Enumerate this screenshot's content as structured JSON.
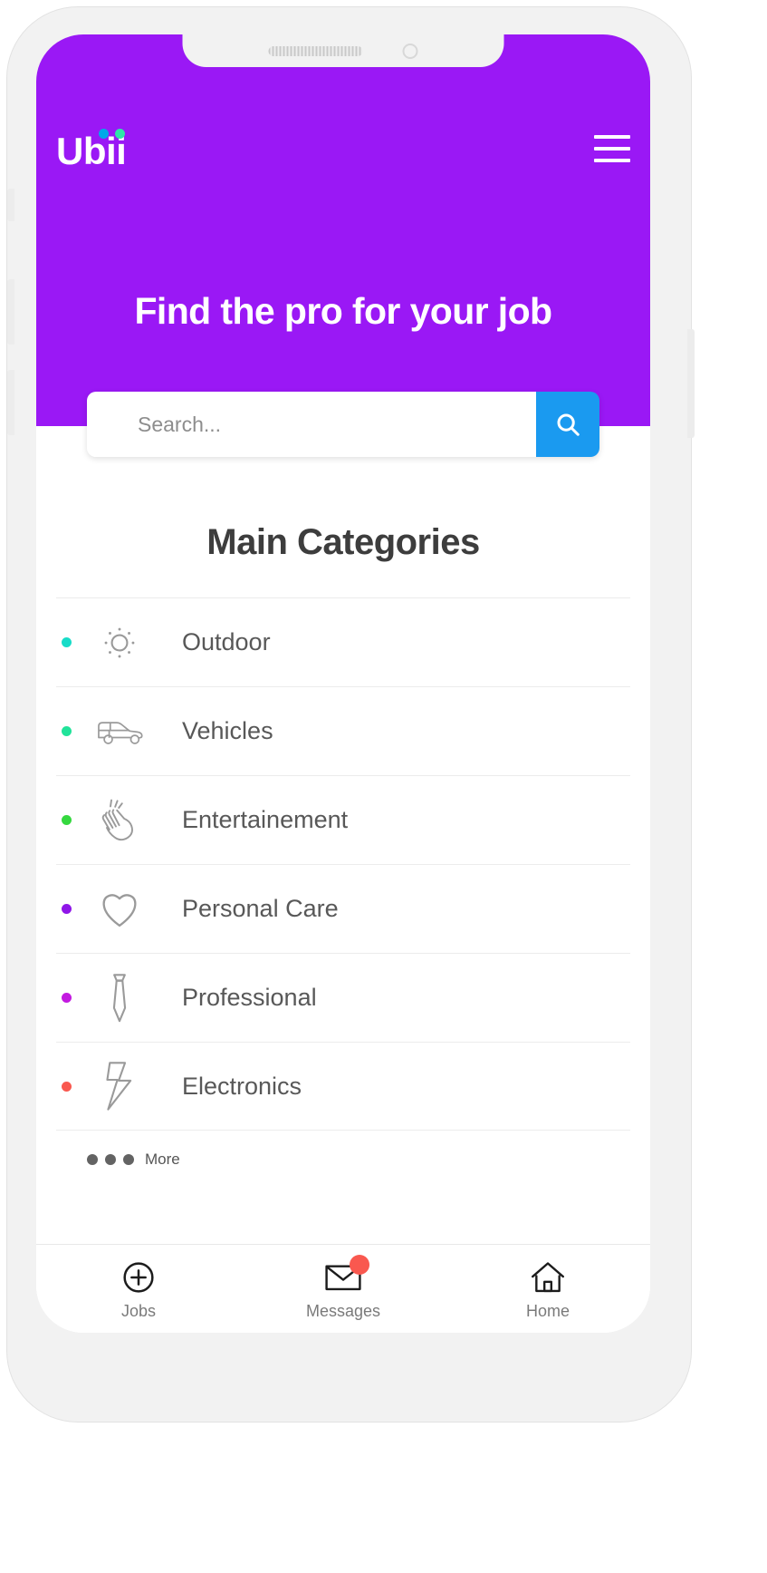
{
  "app": {
    "logo_text": "Ubii",
    "logo_dot_color_1": "#00a8e8",
    "logo_dot_color_2": "#2ee6a8",
    "brand_purple": "#9a18f5",
    "accent_blue": "#1a9af0"
  },
  "header": {
    "menu_icon": "hamburger-menu-icon"
  },
  "hero": {
    "title": "Find the pro for your job"
  },
  "search": {
    "placeholder": "Search...",
    "value": "",
    "button_icon": "search-icon"
  },
  "main": {
    "section_title": "Main Categories",
    "categories": [
      {
        "label": "Outdoor",
        "icon": "sun-icon",
        "dot_color": "#18dcc8"
      },
      {
        "label": "Vehicles",
        "icon": "car-icon",
        "dot_color": "#21e39a"
      },
      {
        "label": "Entertainement",
        "icon": "clapping-hands-icon",
        "dot_color": "#35d83f"
      },
      {
        "label": "Personal Care",
        "icon": "heart-shield-icon",
        "dot_color": "#8f16e8"
      },
      {
        "label": "Professional",
        "icon": "necktie-icon",
        "dot_color": "#c31ae0"
      },
      {
        "label": "Electronics",
        "icon": "lightning-bolt-icon",
        "dot_color": "#f9584f"
      }
    ],
    "pagination": {
      "dots": 3,
      "more_label": "More"
    }
  },
  "bottom_nav": {
    "items": [
      {
        "label": "Jobs",
        "icon": "plus-circle-icon",
        "badge": false
      },
      {
        "label": "Messages",
        "icon": "envelope-icon",
        "badge": true,
        "badge_color": "#f9584f"
      },
      {
        "label": "Home",
        "icon": "home-icon",
        "badge": false
      }
    ]
  }
}
